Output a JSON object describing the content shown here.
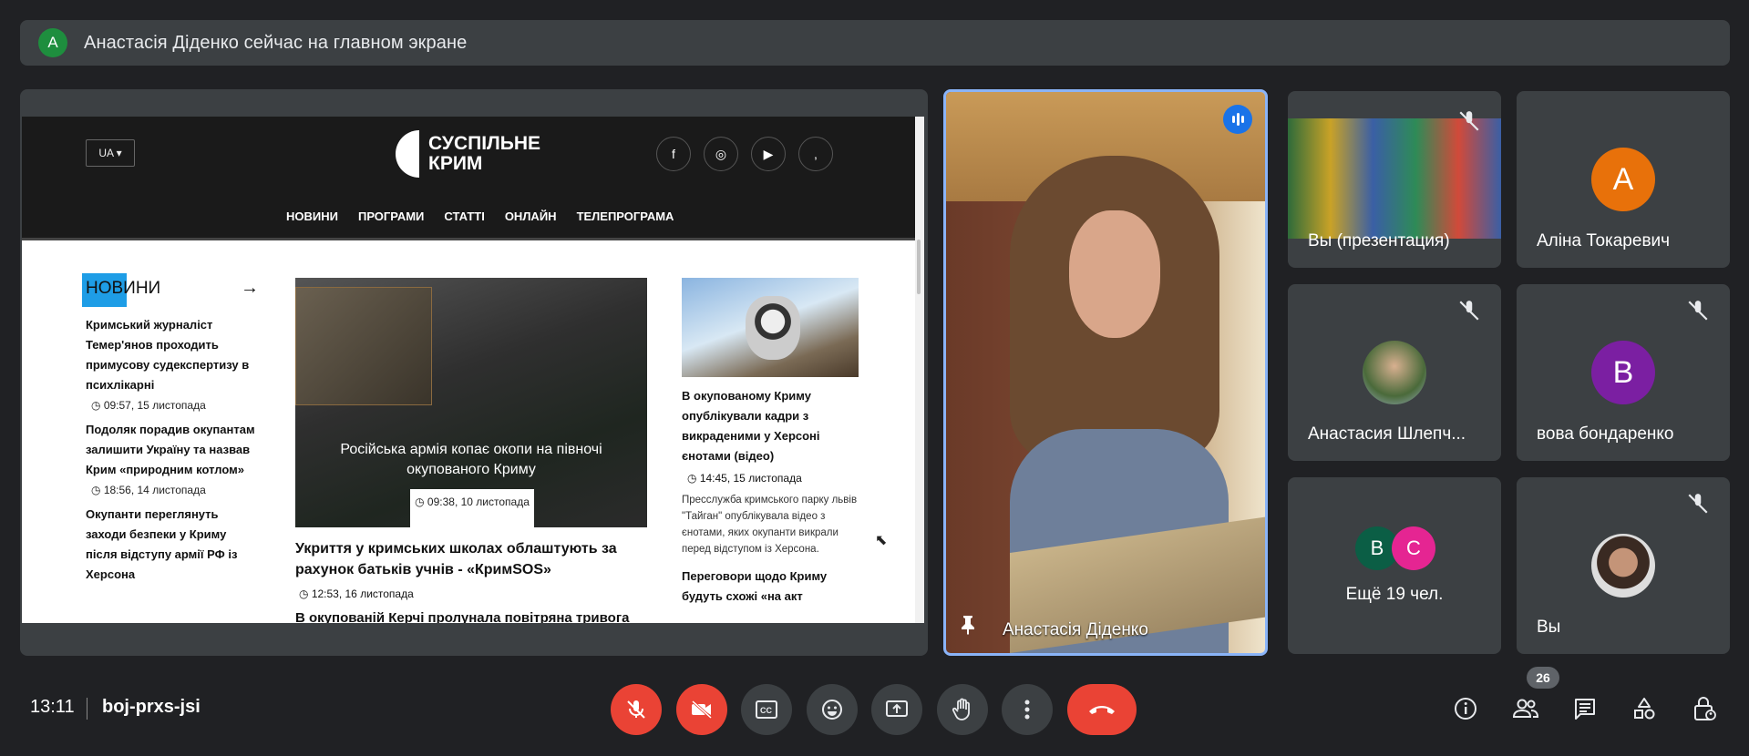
{
  "banner": {
    "avatar_letter": "А",
    "text": "Анастасія Діденко сейчас на главном экране"
  },
  "presentation": {
    "site": {
      "lang": "UA ▾",
      "logo_line1": "СУСПІЛЬНЕ",
      "logo_line2": "КРИМ",
      "social": [
        "f",
        "◎",
        "▶",
        ","
      ],
      "menu": [
        "НОВИНИ",
        "ПРОГРАМИ",
        "СТАТТІ",
        "ОНЛАЙН",
        "ТЕЛЕПРОГРАМА"
      ],
      "news_heading": "НОВИНИ",
      "news_arrow": "→",
      "news": [
        {
          "title": "Кримський журналіст Темер'янов проходить примусову судекспертизу в психлікарні",
          "time": "09:57, 15 листопада"
        },
        {
          "title": "Подоляк порадив окупантам залишити Україну та назвав Крим «природним котлом»",
          "time": "18:56, 14 листопада"
        },
        {
          "title": "Окупанти переглянуть заходи безпеки у Криму після відступу армії РФ із Херсона",
          "time": ""
        }
      ],
      "featured": {
        "caption": "Російська армія копає окопи на півночі окупованого Криму",
        "date": "09:38, 10 листопада",
        "headline": "Укриття у кримських школах облаштують за рахунок батьків учнів - «КримSOS»",
        "time": "12:53, 16 листопада",
        "next_headline": "В окупованій Керчі пролунала повітряна тривога"
      },
      "side": {
        "headline": "В окупованому Криму опублікували кадри з викраденими у Херсоні єнотами (відео)",
        "time": "14:45, 15 листопада",
        "text": "Пресслужба кримського парку львів \"Тайган\" опублікувала відео з єнотами, яких окупанти викрали перед відступом із Херсона.",
        "next_headline": "Переговори щодо Криму будуть схожі «на акт"
      }
    }
  },
  "speaker": {
    "name": "Анастасія Діденко"
  },
  "tiles": [
    {
      "name": "Вы (презентация)"
    },
    {
      "name": "Аліна Токаревич",
      "letter": "А",
      "color": "#e8710a"
    },
    {
      "name": "Анастасия Шлепч..."
    },
    {
      "name": "вова бондаренко",
      "letter": "B",
      "color": "#7b1fa2"
    },
    {
      "name": "Ещё 19 чел.",
      "letters": [
        "B",
        "C"
      ],
      "colors": [
        "#0b5e45",
        "#e52592"
      ]
    },
    {
      "name": "Вы"
    }
  ],
  "bottom": {
    "time": "13:11",
    "meeting_code": "boj-prxs-jsi",
    "participants_count": "26"
  }
}
